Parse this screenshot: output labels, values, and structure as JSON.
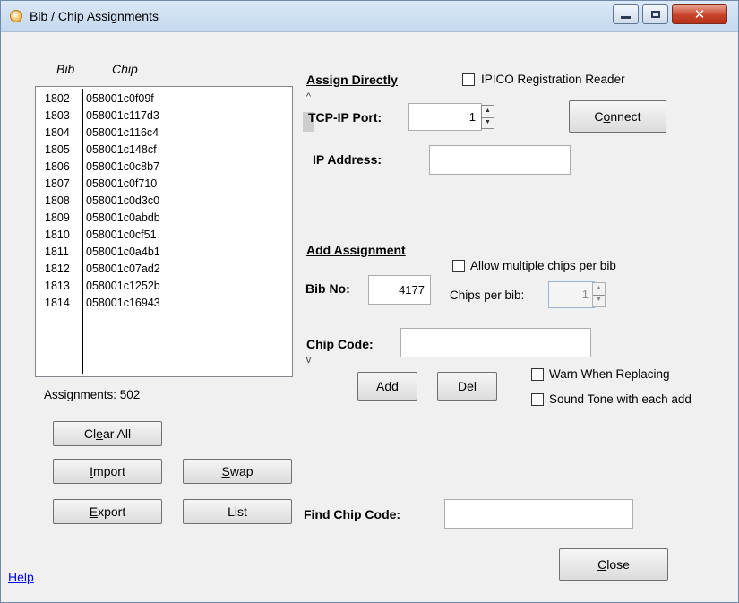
{
  "window": {
    "title": "Bib / Chip Assignments",
    "close_glyph": "✕"
  },
  "list": {
    "bib_header": "Bib",
    "chip_header": "Chip",
    "rows": [
      {
        "bib": "1802",
        "chip": "058001c0f09f"
      },
      {
        "bib": "1803",
        "chip": "058001c117d3"
      },
      {
        "bib": "1804",
        "chip": "058001c116c4"
      },
      {
        "bib": "1805",
        "chip": "058001c148cf"
      },
      {
        "bib": "1806",
        "chip": "058001c0c8b7"
      },
      {
        "bib": "1807",
        "chip": "058001c0f710"
      },
      {
        "bib": "1808",
        "chip": "058001c0d3c0"
      },
      {
        "bib": "1809",
        "chip": "058001c0abdb"
      },
      {
        "bib": "1810",
        "chip": "058001c0cf51"
      },
      {
        "bib": "1811",
        "chip": "058001c0a4b1"
      },
      {
        "bib": "1812",
        "chip": "058001c07ad2"
      },
      {
        "bib": "1813",
        "chip": "058001c1252b"
      },
      {
        "bib": "1814",
        "chip": "058001c16943"
      }
    ],
    "assignments_label": "Assignments: 502",
    "scroll_up": "^",
    "scroll_down": "v"
  },
  "left_buttons": {
    "clear_all_pre": "Cl",
    "clear_all_ul": "e",
    "clear_all_post": "ar All",
    "import_ul": "I",
    "import_post": "mport",
    "swap_ul": "S",
    "swap_post": "wap",
    "export_ul": "E",
    "export_post": "xport",
    "list": "List"
  },
  "assign_directly": {
    "title": "Assign Directly",
    "ipico_label": "IPICO Registration Reader",
    "port_label": "TCP-IP Port:",
    "port_value": "1",
    "connect_pre": "C",
    "connect_ul": "o",
    "connect_post": "nnect",
    "ip_label": "IP Address:",
    "ip_value": ""
  },
  "add_assignment": {
    "title": "Add Assignment",
    "allow_multi_label": "Allow multiple chips per bib",
    "bib_label": "Bib No:",
    "bib_value": "4177",
    "chips_per_bib_label": "Chips per bib:",
    "chips_per_bib_value": "1",
    "chip_code_label": "Chip Code:",
    "chip_code_value": "",
    "add_ul": "A",
    "add_post": "dd",
    "del_ul": "D",
    "del_post": "el",
    "warn_label": "Warn When Replacing",
    "sound_label": "Sound Tone with each add"
  },
  "find": {
    "label": "Find Chip Code:",
    "value": ""
  },
  "footer": {
    "help": "Help",
    "close_ul": "C",
    "close_post": "lose"
  },
  "spin": {
    "up": "▲",
    "down": "▼"
  }
}
